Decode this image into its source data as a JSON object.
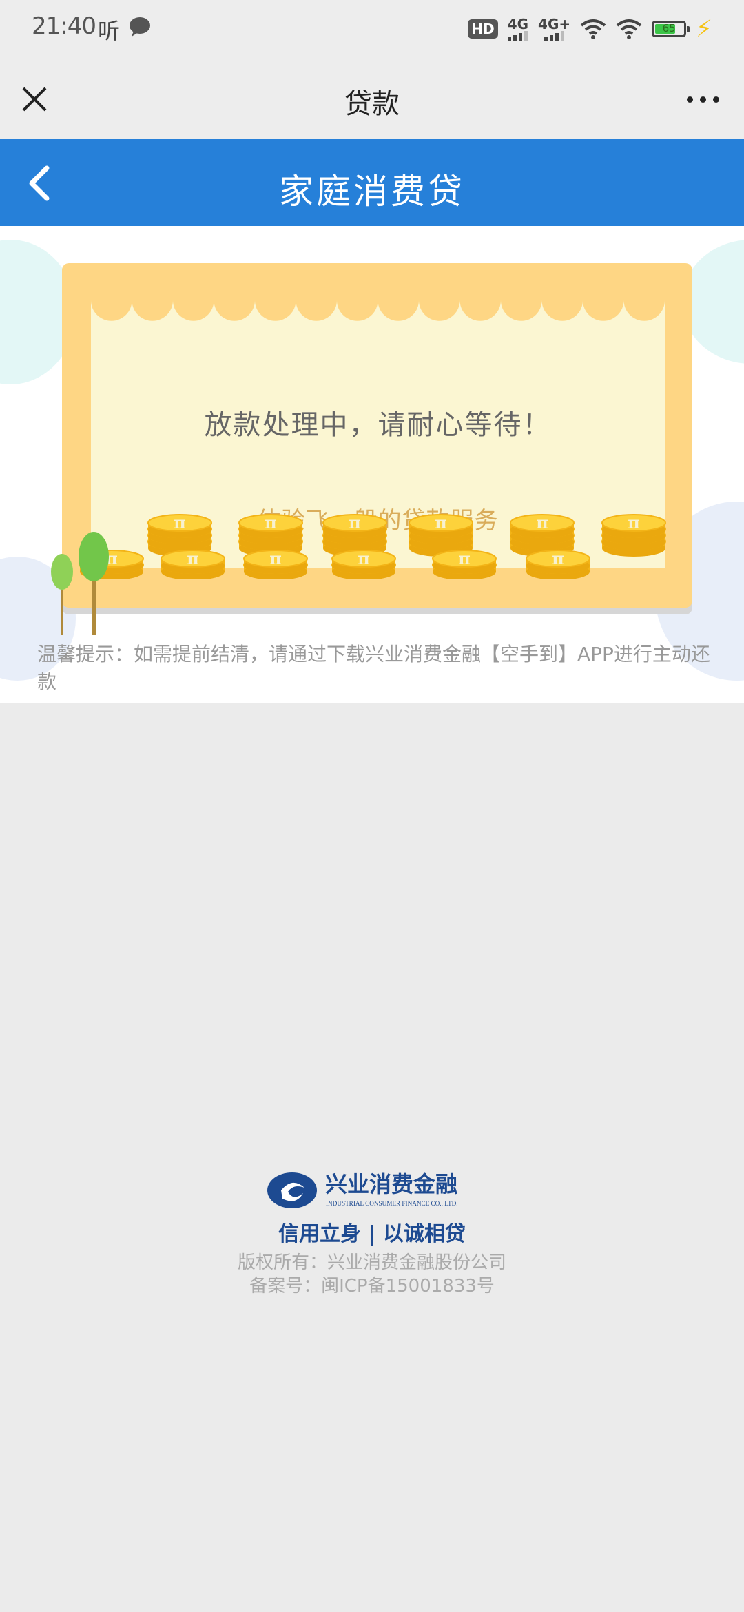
{
  "status_bar": {
    "time": "21:40",
    "ting": "听",
    "hd": "HD",
    "net1": "4G",
    "net2": "4G+",
    "battery": "65"
  },
  "title_bar": {
    "title": "贷款"
  },
  "header": {
    "title": "家庭消费贷"
  },
  "card": {
    "status": "放款处理中，请耐心等待！",
    "slogan": "体验飞一般的贷款服务"
  },
  "tip": "温馨提示：如需提前结清，请通过下载兴业消费金融【空手到】APP进行主动还款",
  "footer": {
    "brand_cn": "兴业消费金融",
    "brand_en": "INDUSTRIAL CONSUMER FINANCE CO., LTD.",
    "motto": "信用立身 | 以诚相贷",
    "copyright": "版权所有：兴业消费金融股份公司",
    "icp": "备案号：闽ICP备15001833号"
  },
  "colors": {
    "brand_blue": "#2680d9",
    "card_orange": "#fed684",
    "card_cream": "#fbf6d2",
    "slogan_gold": "#d9ac5a",
    "footer_blue": "#1d4a91"
  },
  "icons": [
    "close-icon",
    "more-icon",
    "back-icon",
    "coin-icon",
    "tree-icon",
    "brand-logo"
  ]
}
